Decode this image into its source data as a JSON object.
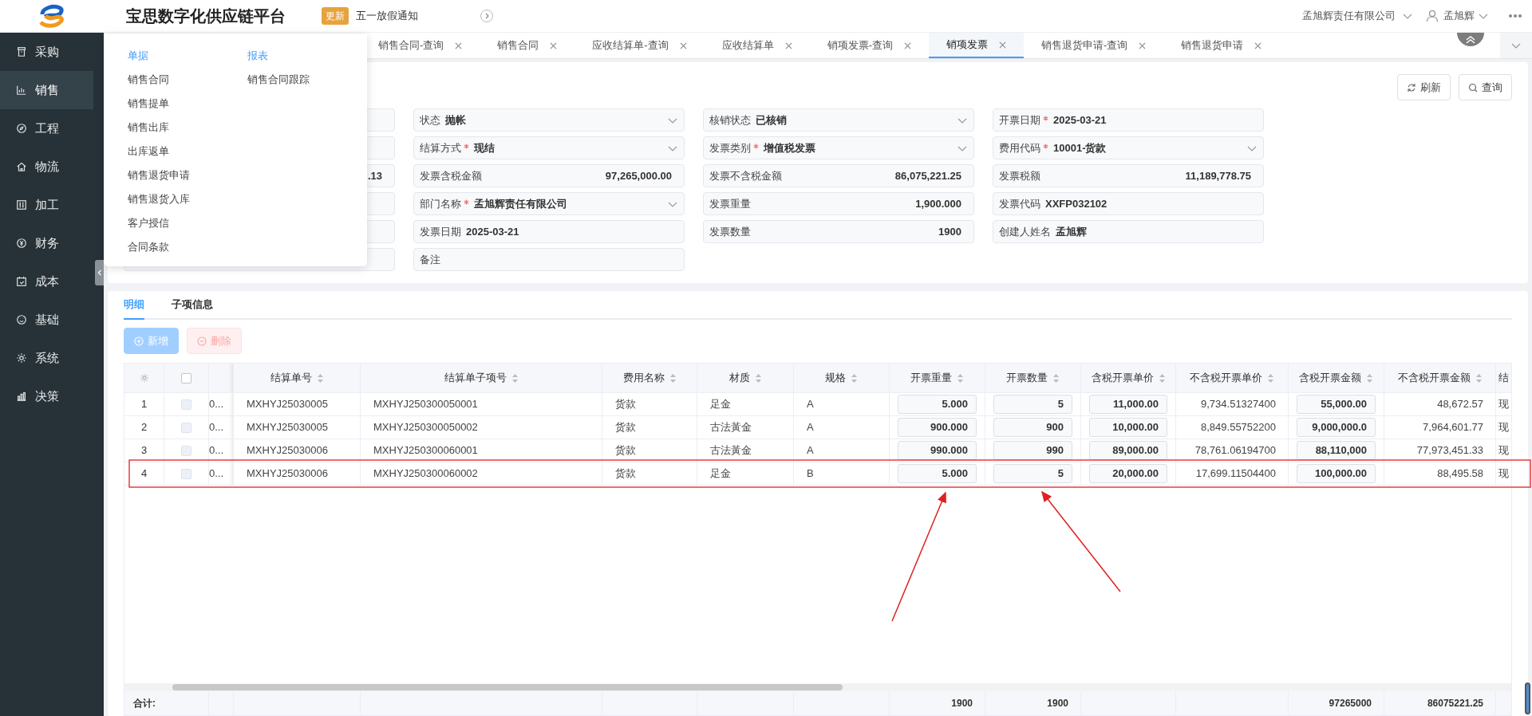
{
  "header": {
    "title": "宝思数字化供应链平台",
    "badge": "更新",
    "notice": "五一放假通知",
    "company": "孟旭辉责任有限公司",
    "user": "孟旭辉"
  },
  "sidebar": {
    "items": [
      {
        "label": "采购",
        "selected": false
      },
      {
        "label": "销售",
        "selected": true
      },
      {
        "label": "工程",
        "selected": false
      },
      {
        "label": "物流",
        "selected": false
      },
      {
        "label": "加工",
        "selected": false
      },
      {
        "label": "财务",
        "selected": false
      },
      {
        "label": "成本",
        "selected": false
      },
      {
        "label": "基础",
        "selected": false
      },
      {
        "label": "系统",
        "selected": false
      },
      {
        "label": "决策",
        "selected": false
      }
    ]
  },
  "menu": {
    "groups": [
      {
        "title": "单据",
        "items": [
          "销售合同",
          "销售提单",
          "销售出库",
          "出库返单",
          "销售退货申请",
          "销售退货入库",
          "客户授信",
          "合同条款"
        ]
      },
      {
        "title": "报表",
        "items": [
          "销售合同跟踪"
        ]
      }
    ]
  },
  "tabs": [
    {
      "label": "销售合同-查询",
      "selected": false
    },
    {
      "label": "销售合同",
      "selected": false
    },
    {
      "label": "应收结算单-查询",
      "selected": false
    },
    {
      "label": "应收结算单",
      "selected": false
    },
    {
      "label": "销项发票-查询",
      "selected": false
    },
    {
      "label": "销项发票",
      "selected": true
    },
    {
      "label": "销售退货申请-查询",
      "selected": false
    },
    {
      "label": "销售退货申请",
      "selected": false
    }
  ],
  "toolbar": [
    "刷新",
    "查询"
  ],
  "form": {
    "columns": [
      [
        {
          "kind": "text"
        },
        {
          "kind": "text"
        },
        {
          "kind": "number",
          "value": ".13"
        },
        {
          "kind": "text"
        },
        {
          "kind": "text"
        },
        {
          "kind": "text"
        }
      ],
      [
        {
          "kind": "select",
          "label": "状态",
          "required": false,
          "value": "抛帐"
        },
        {
          "kind": "select",
          "label": "结算方式",
          "required": true,
          "value": "现结"
        },
        {
          "kind": "number",
          "label": "发票含税金额",
          "required": false,
          "value": "97,265,000.00"
        },
        {
          "kind": "select",
          "label": "部门名称",
          "required": true,
          "value": "孟旭辉责任有限公司"
        },
        {
          "kind": "text",
          "label": "发票日期",
          "required": false,
          "value": "2025-03-21"
        },
        {
          "kind": "text",
          "label": "备注",
          "required": false
        }
      ],
      [
        {
          "kind": "select",
          "label": "核销状态",
          "required": false,
          "value": "已核销"
        },
        {
          "kind": "select",
          "label": "发票类别",
          "required": true,
          "value": "增值税发票"
        },
        {
          "kind": "number",
          "label": "发票不含税金额",
          "required": false,
          "value": "86,075,221.25"
        },
        {
          "kind": "number",
          "label": "发票重量",
          "required": false,
          "value": "1,900.000"
        },
        {
          "kind": "number",
          "label": "发票数量",
          "required": false,
          "value": "1900"
        }
      ],
      [
        {
          "kind": "text",
          "label": "开票日期",
          "required": true,
          "value": "2025-03-21"
        },
        {
          "kind": "select",
          "label": "费用代码",
          "required": true,
          "value": "10001-货款"
        },
        {
          "kind": "number",
          "label": "发票税额",
          "required": false,
          "value": "11,189,778.75"
        },
        {
          "kind": "text",
          "label": "发票代码",
          "required": false,
          "value": "XXFP032102"
        },
        {
          "kind": "text",
          "label": "创建人姓名",
          "required": false,
          "value": "孟旭辉"
        }
      ]
    ]
  },
  "detail_tabs": [
    {
      "label": "明细",
      "selected": true
    },
    {
      "label": "子项信息",
      "selected": false
    }
  ],
  "detail_buttons": [
    {
      "label": "新增",
      "kind": "add",
      "disabled": true
    },
    {
      "label": "删除",
      "kind": "delete",
      "disabled": true
    }
  ],
  "table": {
    "select_all_checked": false,
    "columns": [
      {
        "kind": "clip"
      },
      {
        "label": "结算单号",
        "kind": "text"
      },
      {
        "label": "结算单子项号",
        "kind": "text"
      },
      {
        "label": "费用名称",
        "kind": "text"
      },
      {
        "label": "材质",
        "kind": "text"
      },
      {
        "label": "规格",
        "kind": "text"
      },
      {
        "label": "开票重量",
        "kind": "input"
      },
      {
        "label": "开票数量",
        "kind": "input"
      },
      {
        "label": "含税开票单价",
        "kind": "input"
      },
      {
        "label": "不含税开票单价",
        "kind": "number"
      },
      {
        "label": "含税开票金额",
        "kind": "input"
      },
      {
        "label": "不含税开票金额",
        "kind": "number"
      },
      {
        "label": "结",
        "kind": "edge"
      }
    ],
    "rows": [
      {
        "index": "1",
        "checked": false,
        "cells": [
          "0...",
          "MXHYJ25030005",
          "MXHYJ250300050001",
          "货款",
          "足金",
          "A",
          "5.000",
          "5",
          "11,000.00",
          "9,734.51327400",
          "55,000.00",
          "48,672.57",
          "现"
        ]
      },
      {
        "index": "2",
        "checked": false,
        "cells": [
          "0...",
          "MXHYJ25030005",
          "MXHYJ250300050002",
          "货款",
          "古法黃金",
          "A",
          "900.000",
          "900",
          "10,000.00",
          "8,849.55752200",
          "9,000,000.0",
          "7,964,601.77",
          "现"
        ]
      },
      {
        "index": "3",
        "checked": false,
        "cells": [
          "0...",
          "MXHYJ25030006",
          "MXHYJ250300060001",
          "货款",
          "古法黃金",
          "A",
          "990.000",
          "990",
          "89,000.00",
          "78,761.06194700",
          "88,110,000",
          "77,973,451.33",
          "现"
        ]
      },
      {
        "index": "4",
        "checked": false,
        "cells": [
          "0...",
          "MXHYJ25030006",
          "MXHYJ250300060002",
          "货款",
          "足金",
          "B",
          "5.000",
          "5",
          "20,000.00",
          "17,699.11504400",
          "100,000.00",
          "88,495.58",
          "现"
        ]
      }
    ],
    "totals": {
      "label": "合计:",
      "cells": [
        "",
        "",
        "",
        "",
        "",
        "",
        "1900",
        "1900",
        "",
        "",
        "97265000",
        "86075221.25",
        ""
      ]
    }
  }
}
